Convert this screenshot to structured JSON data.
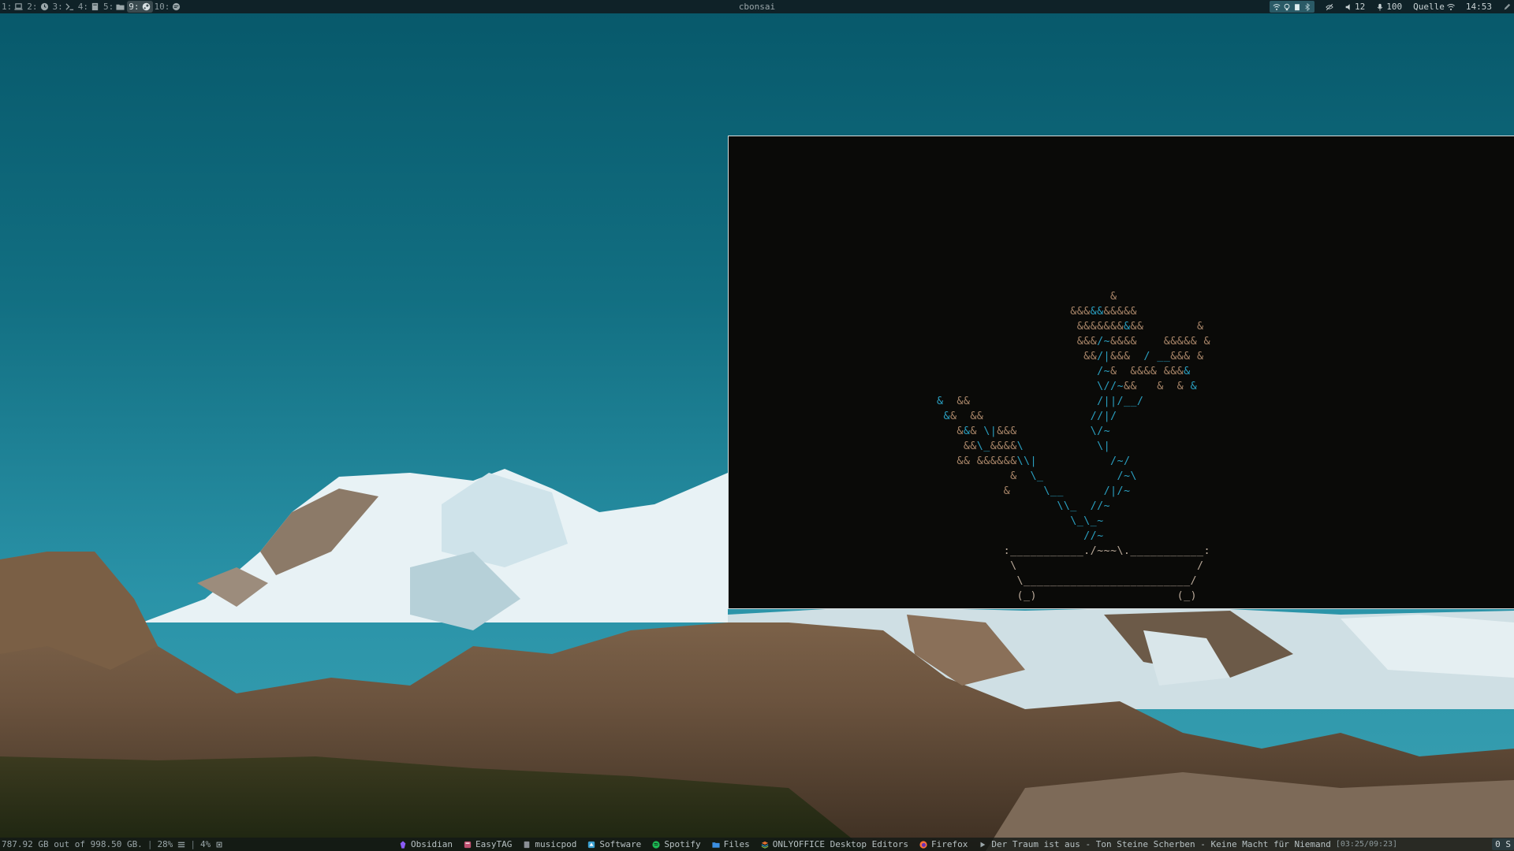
{
  "topbar": {
    "window_title": "cbonsai",
    "workspaces": [
      {
        "num": "1:",
        "icon": "laptop-icon",
        "active": false
      },
      {
        "num": "2:",
        "icon": "clock-icon",
        "active": false
      },
      {
        "num": "3:",
        "icon": "terminal-icon",
        "active": false
      },
      {
        "num": "4:",
        "icon": "book-icon",
        "active": false
      },
      {
        "num": "5:",
        "icon": "folder-icon",
        "active": false
      },
      {
        "num": "9:",
        "icon": "steam-icon",
        "active": true
      },
      {
        "num": "10:",
        "icon": "chat-icon",
        "active": false
      }
    ],
    "status": {
      "mute_label": "",
      "volume": "12",
      "mic": "100",
      "audio_source": "Quelle",
      "clock": "14:53"
    }
  },
  "terminal": {
    "app": "cbonsai"
  },
  "bottombar": {
    "disk": "787.92 GB out of 998.50 GB.",
    "mem": "28%",
    "cpu": "4%",
    "tasks": [
      {
        "label": "Obsidian",
        "icon": "obsidian-icon",
        "color": "#8a5cf5"
      },
      {
        "label": "EasyTAG",
        "icon": "easytag-icon",
        "color": "#c05070"
      },
      {
        "label": "musicpod",
        "icon": "musicpod-icon",
        "color": "#8a8f95"
      },
      {
        "label": "Software",
        "icon": "software-icon",
        "color": "#3aa0d0"
      },
      {
        "label": "Spotify",
        "icon": "spotify-icon",
        "color": "#1db954"
      },
      {
        "label": "Files",
        "icon": "files-icon",
        "color": "#3b8fe0"
      },
      {
        "label": "ONLYOFFICE Desktop Editors",
        "icon": "onlyoffice-icon",
        "color": "#e07030"
      },
      {
        "label": "Firefox",
        "icon": "firefox-icon",
        "color": "#ff7139"
      }
    ],
    "now_playing": "Der Traum ist aus - Ton Steine Scherben - Keine Macht für Niemand",
    "now_playing_time": "[03:25/09:23]",
    "counter": "0 S"
  },
  "colors": {
    "topbar_bg": "#0f2228",
    "terminal_bg": "#0a0a08",
    "bonsai_leaf_brown": "#a88568",
    "bonsai_leaf_blue": "#2a9fc0",
    "sky": "#1b7f92"
  }
}
